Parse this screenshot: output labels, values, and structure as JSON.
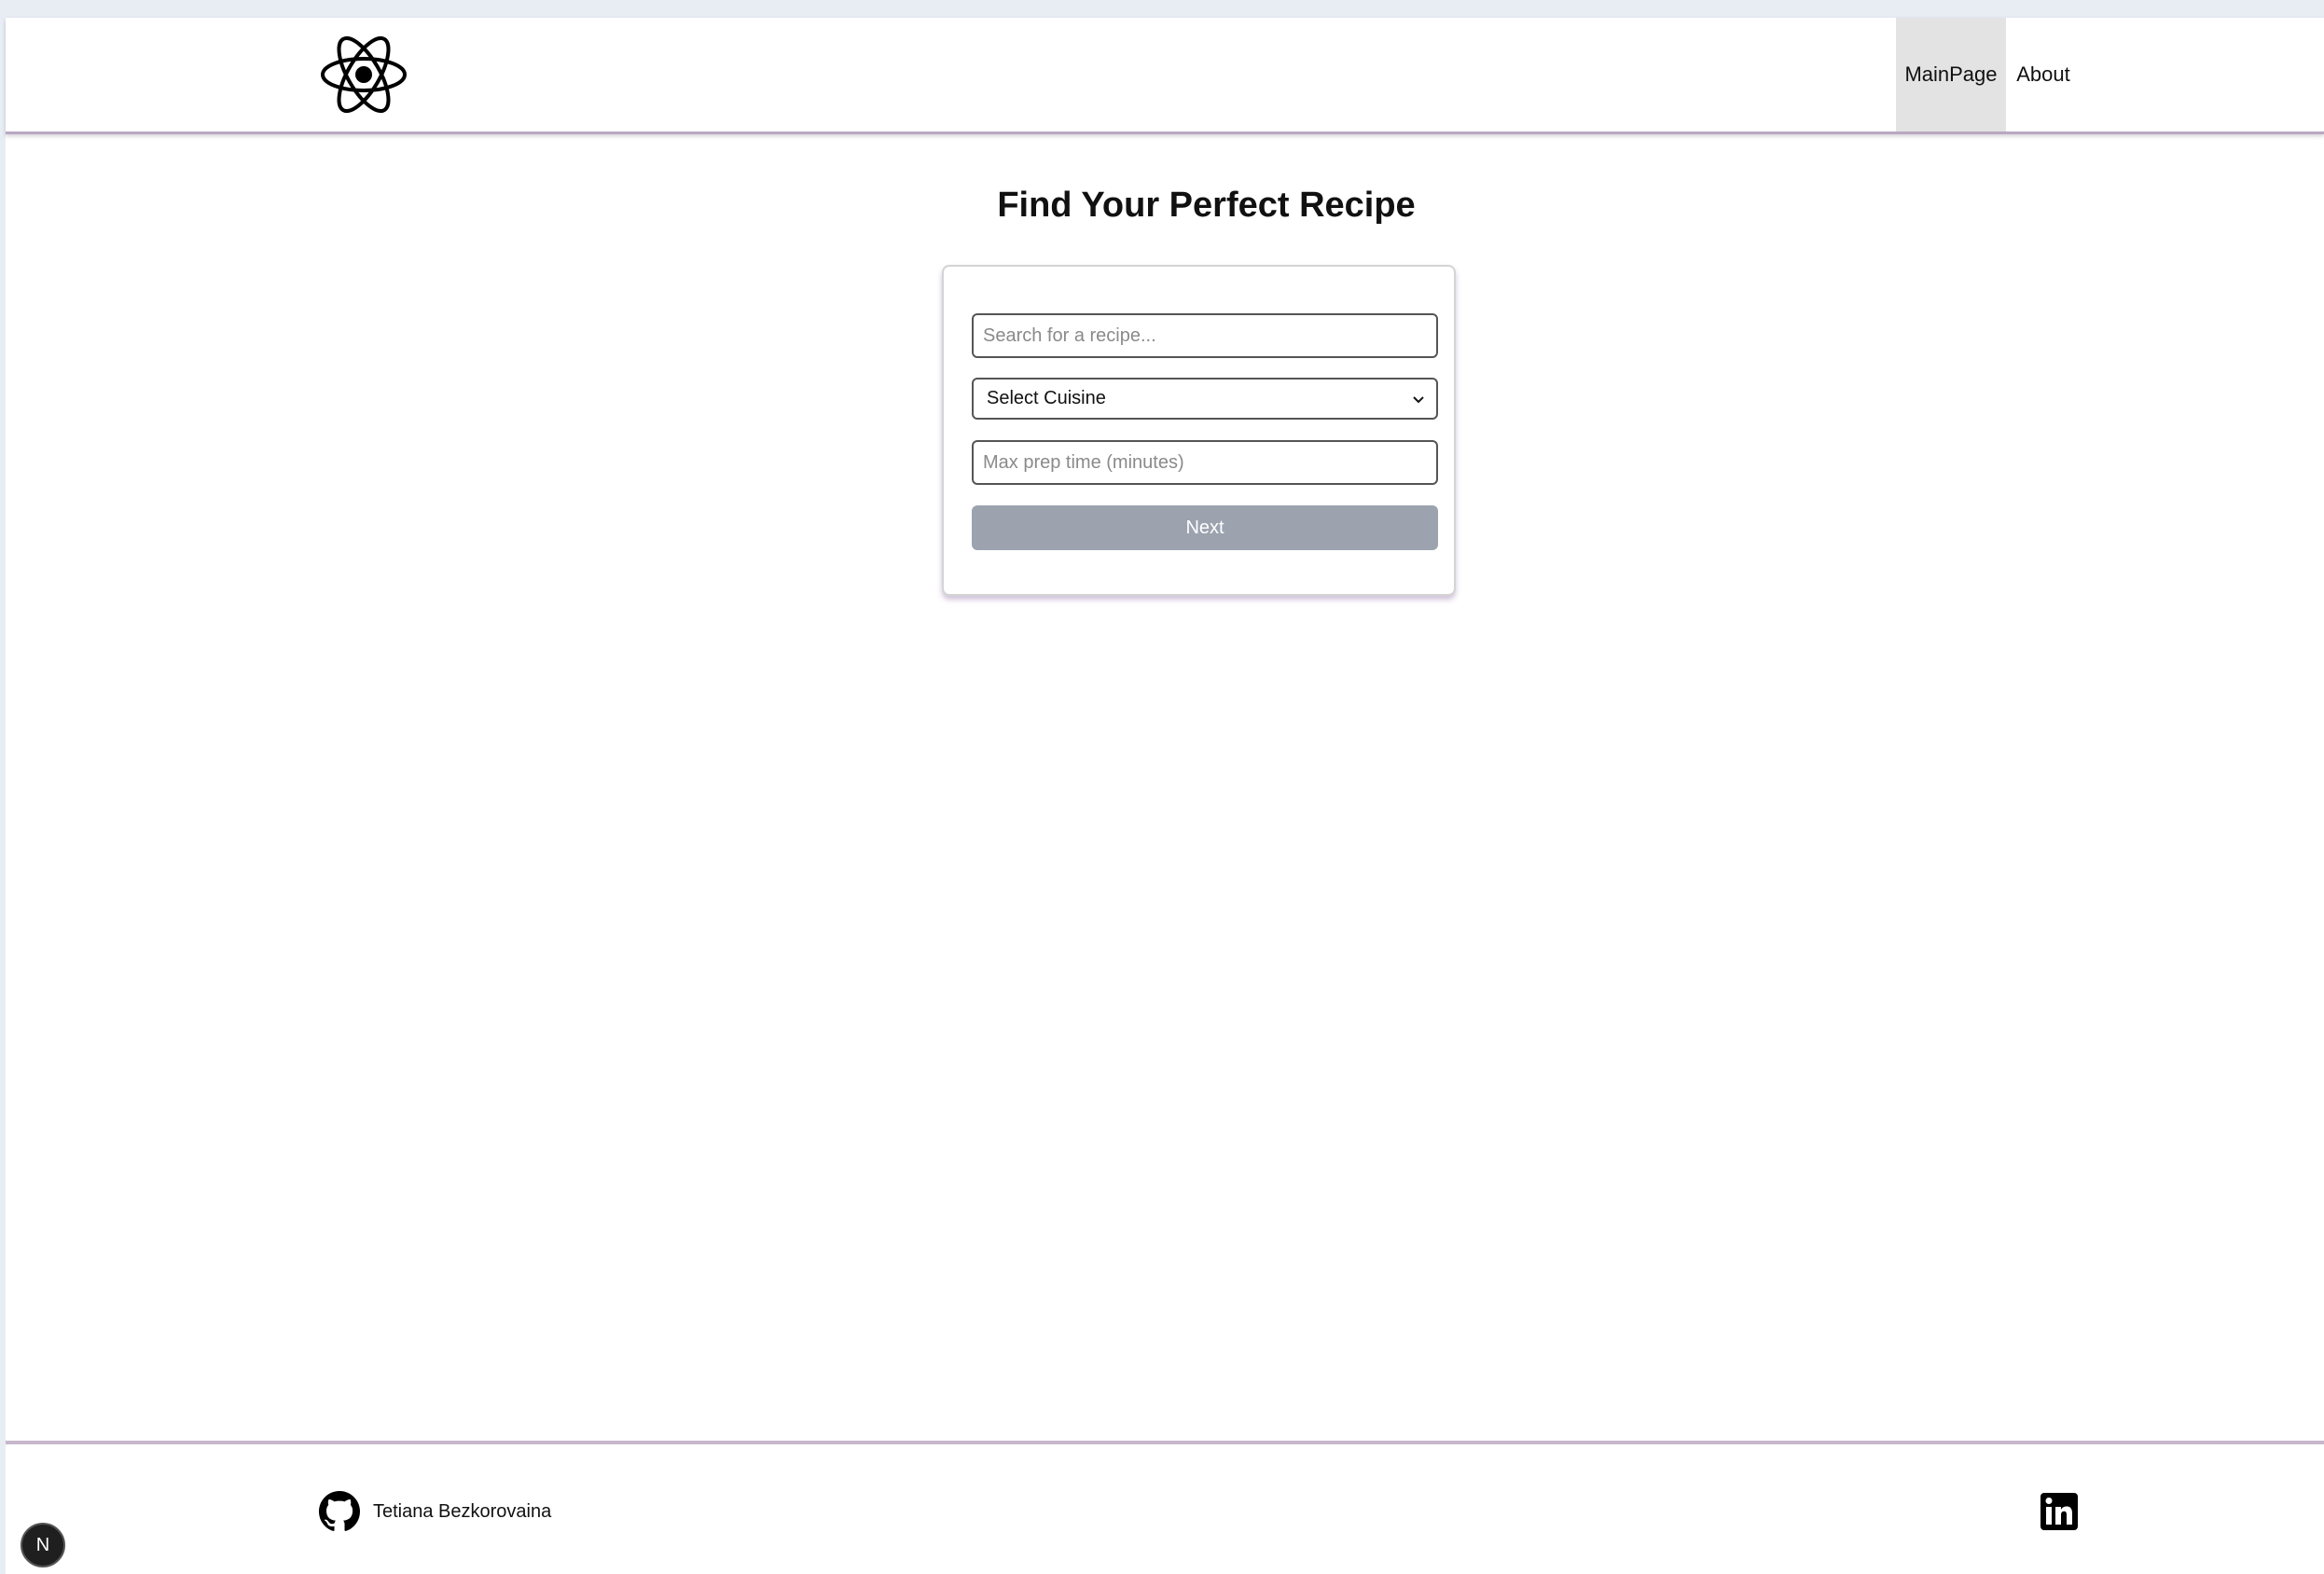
{
  "header": {
    "logo_icon": "react-atom-icon",
    "nav": [
      {
        "label": "MainPage",
        "active": true
      },
      {
        "label": "About",
        "active": false
      }
    ]
  },
  "main": {
    "title": "Find Your Perfect Recipe",
    "search": {
      "placeholder": "Search for a recipe...",
      "value": ""
    },
    "cuisine_select": {
      "selected": "Select Cuisine"
    },
    "prep_time": {
      "placeholder": "Max prep time (minutes)",
      "value": ""
    },
    "next_button": "Next"
  },
  "footer": {
    "github_icon": "github-icon",
    "author": "Tetiana Bezkorovaina",
    "linkedin_icon": "linkedin-icon"
  },
  "devtools": {
    "badge": "N"
  },
  "colors": {
    "button_disabled": "#9ca3af",
    "active_nav_bg": "#e3e3e3",
    "header_border": "#b8a8c0"
  }
}
